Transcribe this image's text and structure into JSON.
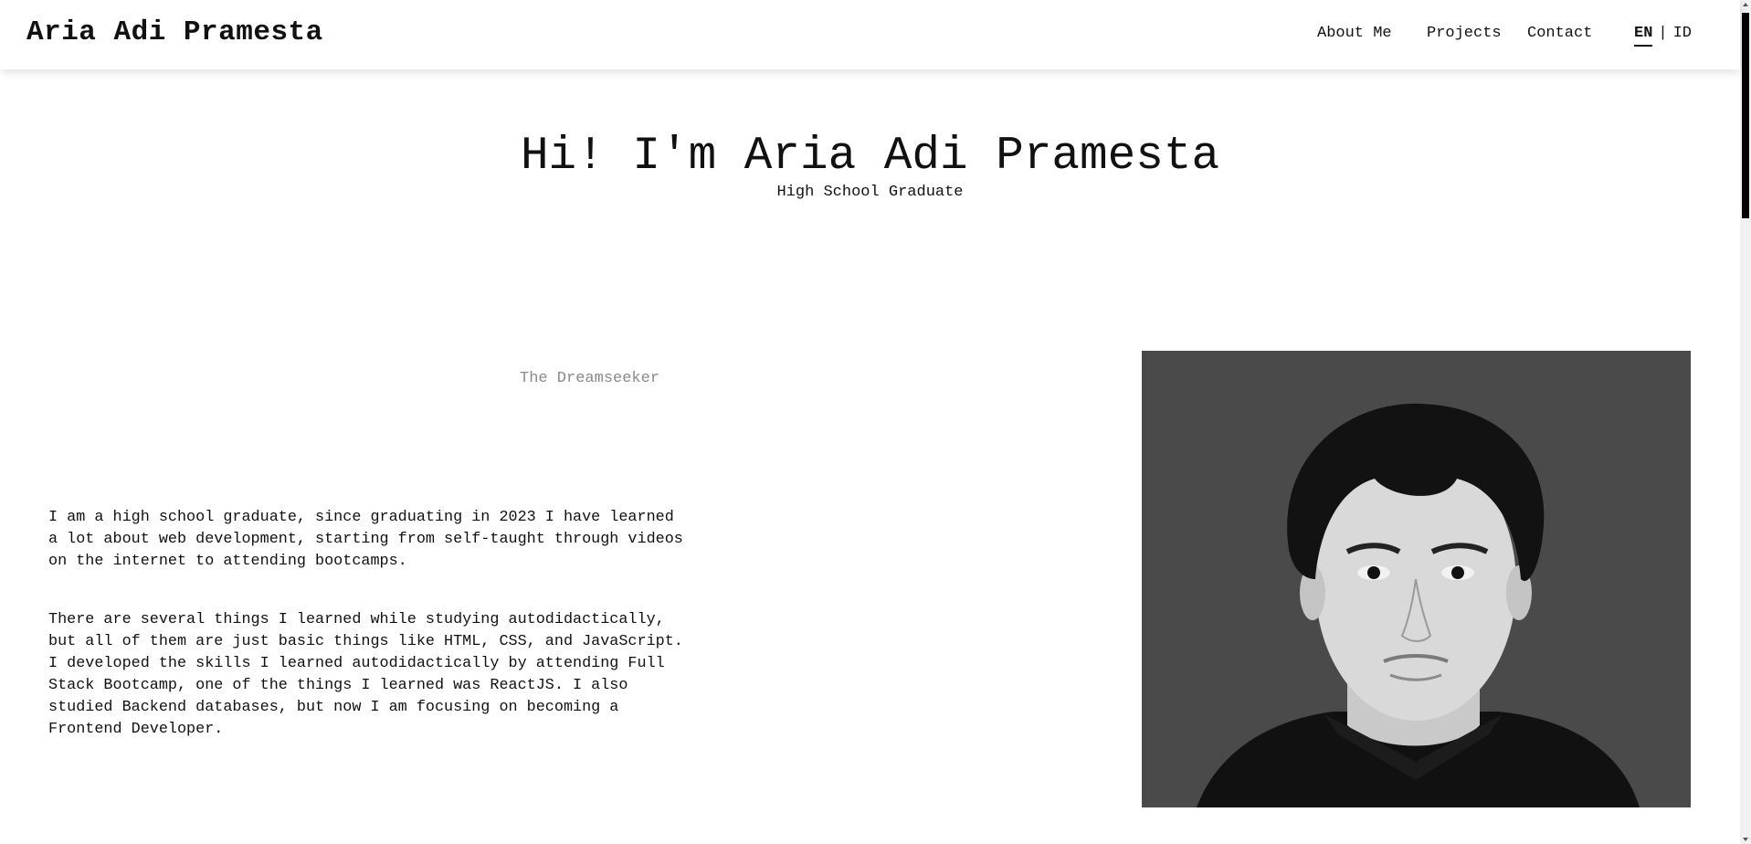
{
  "header": {
    "brand": "Aria Adi Pramesta",
    "nav": [
      {
        "label": "About Me"
      },
      {
        "label": "Projects"
      },
      {
        "label": "Contact"
      }
    ],
    "lang": {
      "active": "EN",
      "separator": "|",
      "other": "ID"
    }
  },
  "hero": {
    "title": "Hi! I'm Aria Adi Pramesta",
    "subtitle": "High School Graduate"
  },
  "about": {
    "tagline": "The Dreamseeker",
    "paragraphs": [
      "I am a high school graduate, since graduating in 2023 I have learned a lot about web development, starting from self-taught through videos on the internet to attending bootcamps.",
      "There are several things I learned while studying autodidactically, but all of them are just basic things like HTML, CSS, and JavaScript. I developed the skills I learned autodidactically by attending Full Stack Bootcamp, one of the things I learned was ReactJS. I also studied Backend databases, but now I am focusing on becoming a Frontend Developer."
    ]
  },
  "colors": {
    "background": "#ffffff",
    "text": "#111111",
    "tagline": "#8a8a8a",
    "photo_bg": "#4a4a4a"
  }
}
